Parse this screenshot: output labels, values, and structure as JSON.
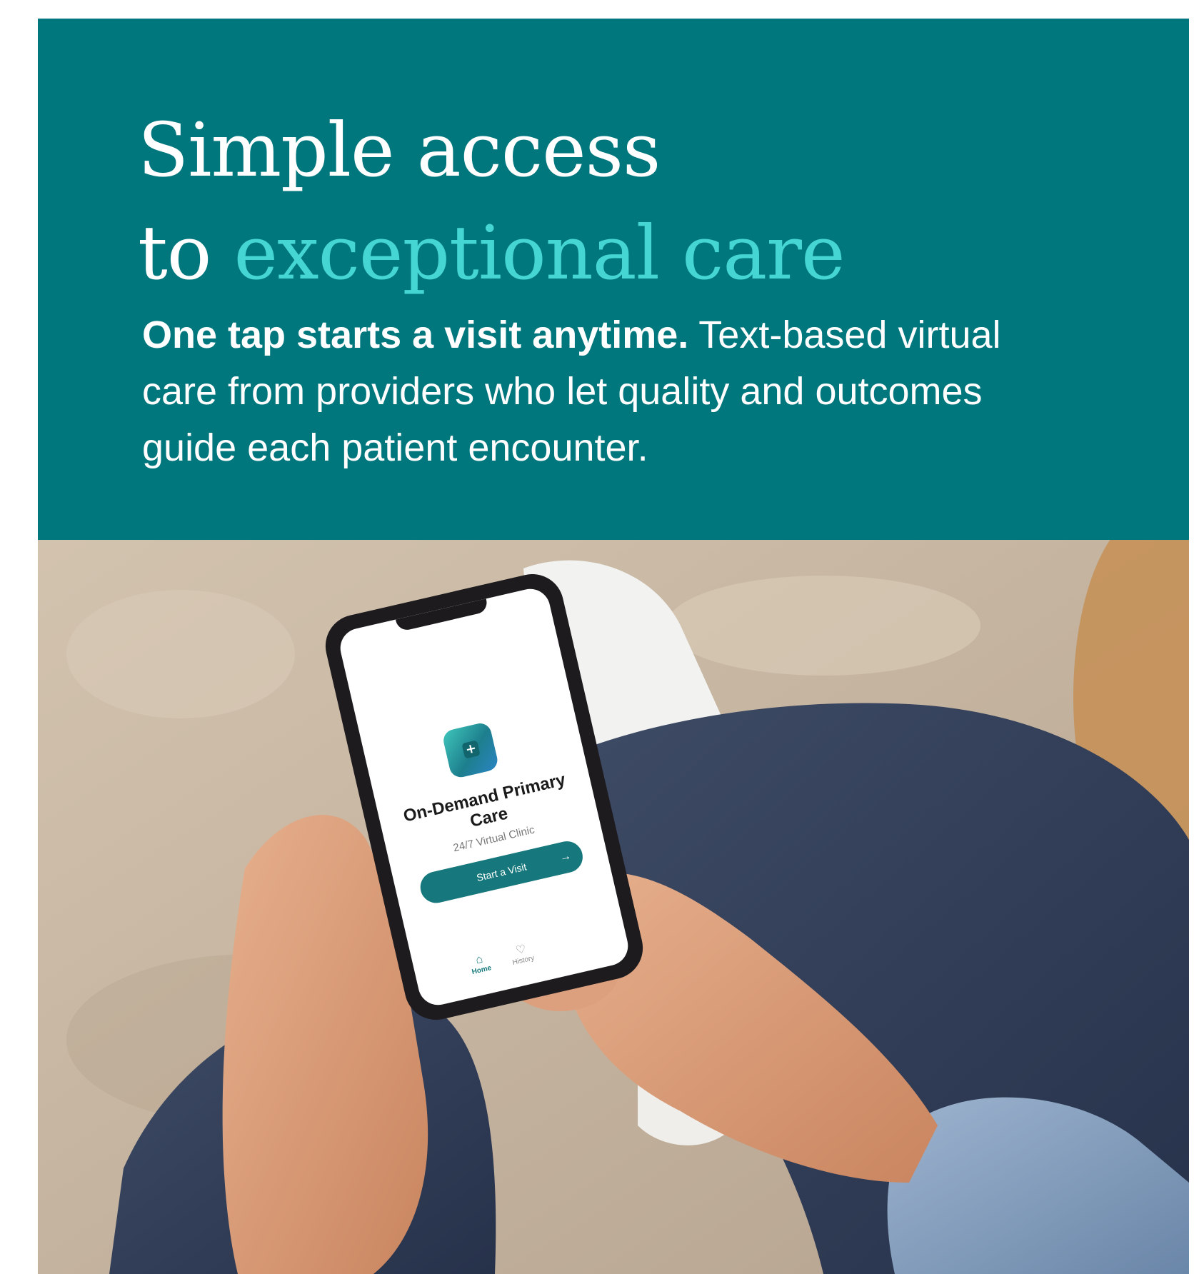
{
  "hero": {
    "headline_line1": "Simple access",
    "headline_line2_plain": "to ",
    "headline_line2_accent": "exceptional care",
    "subtext_bold": "One tap starts a visit anytime.",
    "subtext_rest": " Text-based virtual care from providers who let quality and outcomes guide each patient encounter."
  },
  "colors": {
    "hero_background": "#00767d",
    "accent": "#45d6d3",
    "button": "#16787c"
  },
  "phone_app": {
    "icon": "medical-cross-icon",
    "title": "On-Demand Primary Care",
    "subtitle": "24/7 Virtual Clinic",
    "start_button_label": "Start a Visit",
    "tabs": [
      {
        "label": "Home",
        "icon": "home-icon"
      },
      {
        "label": "History",
        "icon": "heart-icon"
      }
    ]
  }
}
